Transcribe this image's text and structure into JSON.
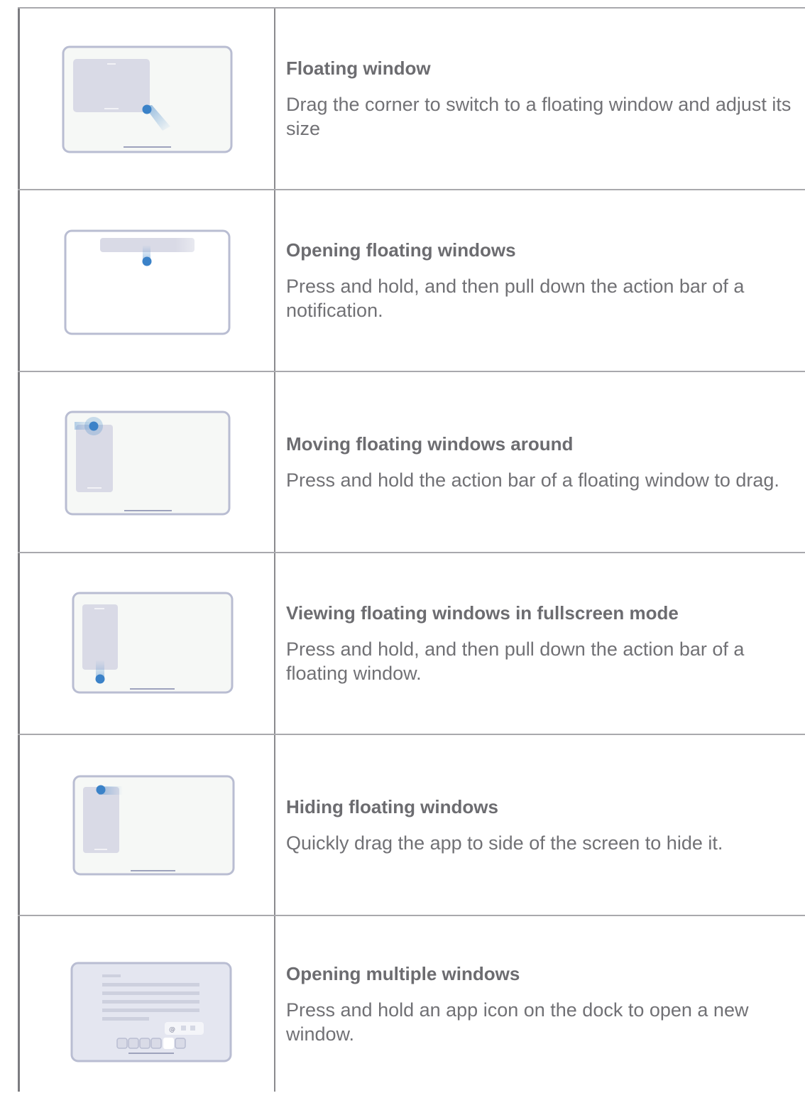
{
  "rows": [
    {
      "title": "Floating window",
      "description": "Drag the corner to switch to a floating window and adjust its size",
      "illustration": "floating-window-resize"
    },
    {
      "title": "Opening floating windows",
      "description": "Press and hold, and then pull down the action bar of a notification.",
      "illustration": "notification-pull-down"
    },
    {
      "title": "Moving floating windows around",
      "description": "Press and hold the action bar of a floating window to drag.",
      "illustration": "floating-window-move"
    },
    {
      "title": "Viewing floating windows in fullscreen mode",
      "description": "Press and hold, and then pull down the action bar of a floating  window.",
      "illustration": "floating-window-fullscreen"
    },
    {
      "title": "Hiding floating windows",
      "description": "Quickly drag the app to side of the screen to hide it.",
      "illustration": "floating-window-hide"
    },
    {
      "title": "Opening multiple windows",
      "description": "Press and hold an app icon on the dock to open a new window.",
      "illustration": "dock-multiple-windows"
    }
  ],
  "colors": {
    "tablet_border": "#b9bdd2",
    "tablet_fill": "#f6f8f6",
    "window_fill": "#d9dae6",
    "touch_dot": "#3b82c8",
    "text": "#6f6f73",
    "rule": "#a9a9ad"
  }
}
